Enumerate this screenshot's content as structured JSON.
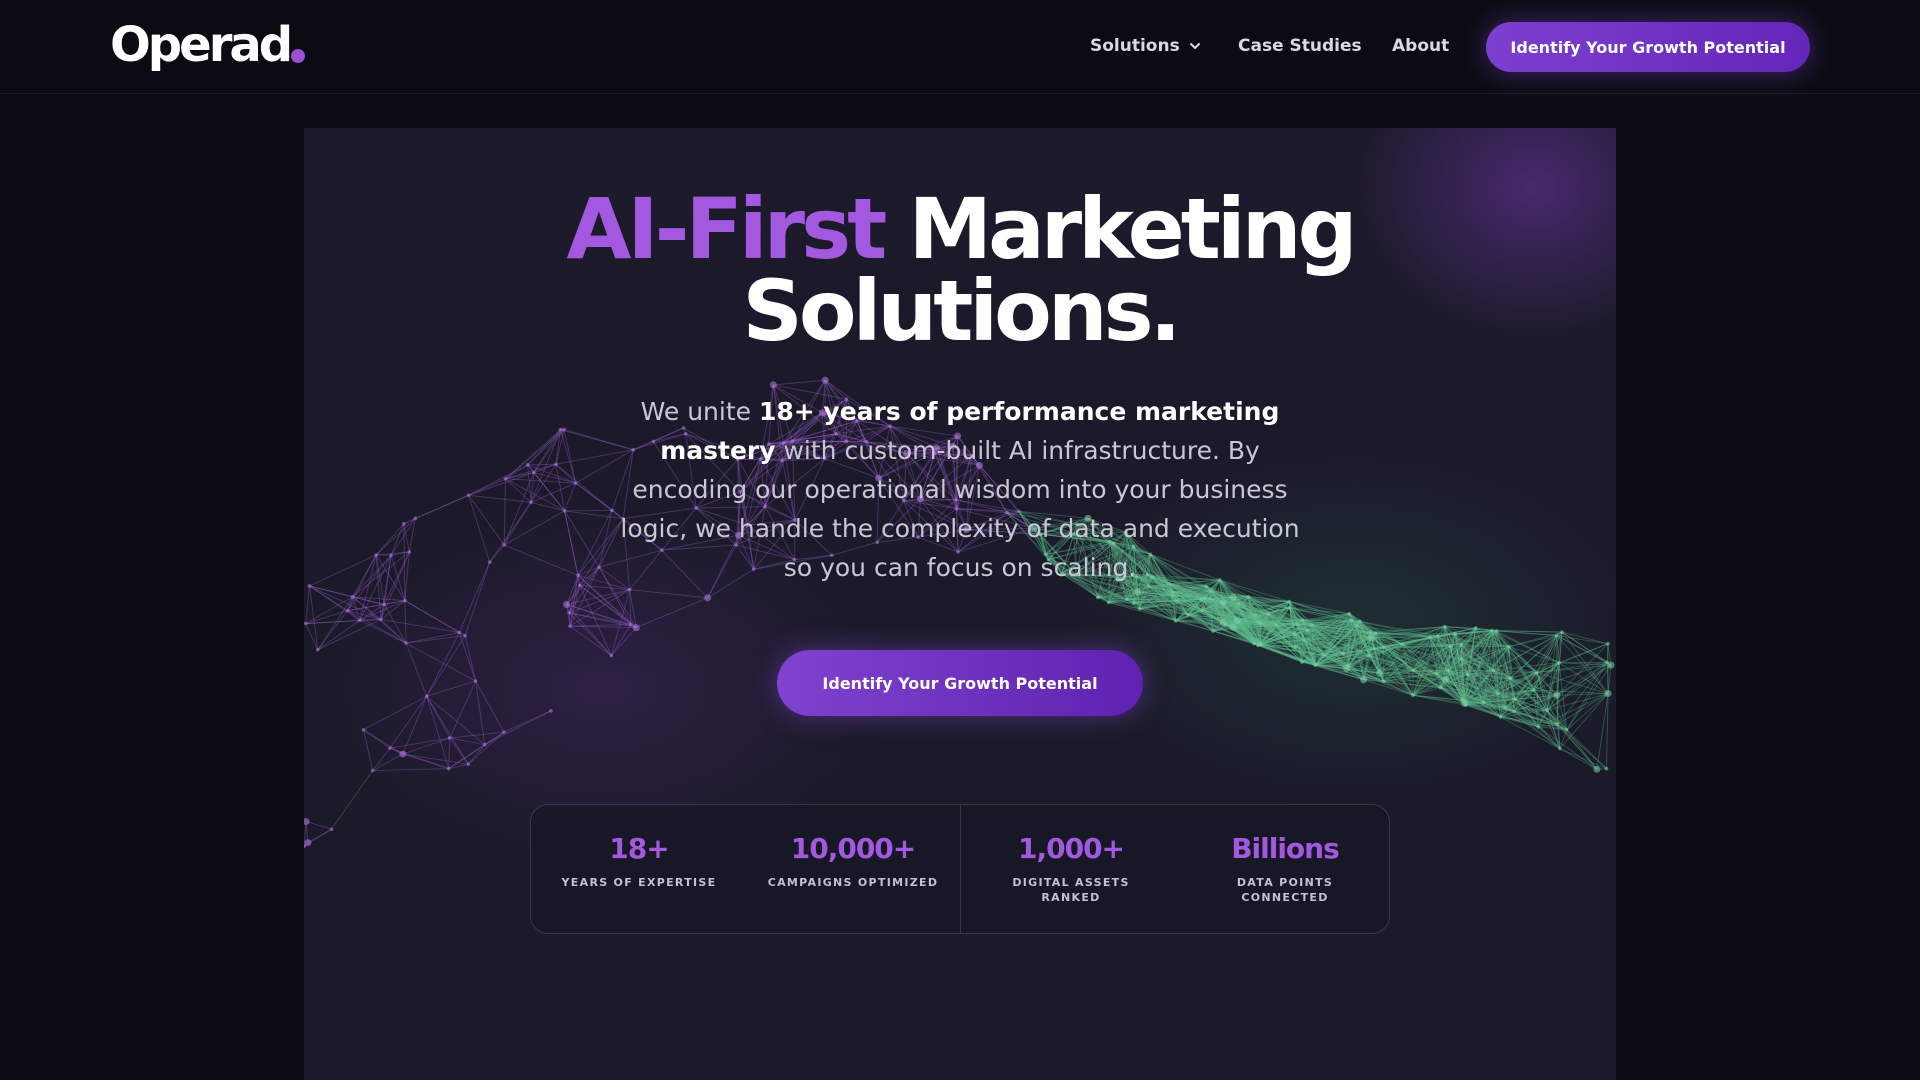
{
  "brand": {
    "logo_text": "Operad",
    "accent_color": "#a259e0"
  },
  "nav": {
    "solutions": "Solutions",
    "case_studies": "Case Studies",
    "about": "About",
    "cta": "Identify Your Growth Potential"
  },
  "hero": {
    "headline_accent": "AI-First",
    "headline_rest_line1": "Marketing",
    "headline_line2": "Solutions.",
    "sub_part1": "We unite ",
    "sub_bold": "18+ years of performance marketing mastery",
    "sub_part2": " with custom-built AI infrastructure. By encoding our operational wisdom into your business logic, we handle the complexity of data and execution so you can focus on scaling.",
    "cta": "Identify Your Growth Potential"
  },
  "stats": [
    {
      "value": "18+",
      "label": "Years of Expertise"
    },
    {
      "value": "10,000+",
      "label": "Campaigns Optimized"
    },
    {
      "value": "1,000+",
      "label": "Digital Assets Ranked"
    },
    {
      "value": "Billions",
      "label": "Data Points Connected"
    }
  ],
  "icons": {
    "dropdown": "chevron-down-icon"
  },
  "colors": {
    "background": "#0c0d14",
    "panel": "#1d1a2b",
    "purple": "#a259e0",
    "button": "#7c3fcf",
    "mesh_green": "#4fae7e"
  }
}
